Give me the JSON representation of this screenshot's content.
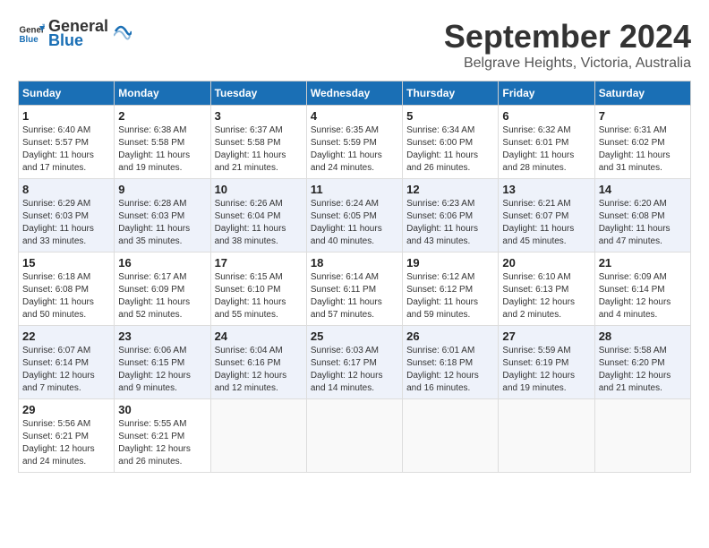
{
  "header": {
    "logo_general": "General",
    "logo_blue": "Blue",
    "month_year": "September 2024",
    "location": "Belgrave Heights, Victoria, Australia"
  },
  "weekdays": [
    "Sunday",
    "Monday",
    "Tuesday",
    "Wednesday",
    "Thursday",
    "Friday",
    "Saturday"
  ],
  "weeks": [
    [
      {
        "day": "1",
        "info": "Sunrise: 6:40 AM\nSunset: 5:57 PM\nDaylight: 11 hours\nand 17 minutes."
      },
      {
        "day": "2",
        "info": "Sunrise: 6:38 AM\nSunset: 5:58 PM\nDaylight: 11 hours\nand 19 minutes."
      },
      {
        "day": "3",
        "info": "Sunrise: 6:37 AM\nSunset: 5:58 PM\nDaylight: 11 hours\nand 21 minutes."
      },
      {
        "day": "4",
        "info": "Sunrise: 6:35 AM\nSunset: 5:59 PM\nDaylight: 11 hours\nand 24 minutes."
      },
      {
        "day": "5",
        "info": "Sunrise: 6:34 AM\nSunset: 6:00 PM\nDaylight: 11 hours\nand 26 minutes."
      },
      {
        "day": "6",
        "info": "Sunrise: 6:32 AM\nSunset: 6:01 PM\nDaylight: 11 hours\nand 28 minutes."
      },
      {
        "day": "7",
        "info": "Sunrise: 6:31 AM\nSunset: 6:02 PM\nDaylight: 11 hours\nand 31 minutes."
      }
    ],
    [
      {
        "day": "8",
        "info": "Sunrise: 6:29 AM\nSunset: 6:03 PM\nDaylight: 11 hours\nand 33 minutes."
      },
      {
        "day": "9",
        "info": "Sunrise: 6:28 AM\nSunset: 6:03 PM\nDaylight: 11 hours\nand 35 minutes."
      },
      {
        "day": "10",
        "info": "Sunrise: 6:26 AM\nSunset: 6:04 PM\nDaylight: 11 hours\nand 38 minutes."
      },
      {
        "day": "11",
        "info": "Sunrise: 6:24 AM\nSunset: 6:05 PM\nDaylight: 11 hours\nand 40 minutes."
      },
      {
        "day": "12",
        "info": "Sunrise: 6:23 AM\nSunset: 6:06 PM\nDaylight: 11 hours\nand 43 minutes."
      },
      {
        "day": "13",
        "info": "Sunrise: 6:21 AM\nSunset: 6:07 PM\nDaylight: 11 hours\nand 45 minutes."
      },
      {
        "day": "14",
        "info": "Sunrise: 6:20 AM\nSunset: 6:08 PM\nDaylight: 11 hours\nand 47 minutes."
      }
    ],
    [
      {
        "day": "15",
        "info": "Sunrise: 6:18 AM\nSunset: 6:08 PM\nDaylight: 11 hours\nand 50 minutes."
      },
      {
        "day": "16",
        "info": "Sunrise: 6:17 AM\nSunset: 6:09 PM\nDaylight: 11 hours\nand 52 minutes."
      },
      {
        "day": "17",
        "info": "Sunrise: 6:15 AM\nSunset: 6:10 PM\nDaylight: 11 hours\nand 55 minutes."
      },
      {
        "day": "18",
        "info": "Sunrise: 6:14 AM\nSunset: 6:11 PM\nDaylight: 11 hours\nand 57 minutes."
      },
      {
        "day": "19",
        "info": "Sunrise: 6:12 AM\nSunset: 6:12 PM\nDaylight: 11 hours\nand 59 minutes."
      },
      {
        "day": "20",
        "info": "Sunrise: 6:10 AM\nSunset: 6:13 PM\nDaylight: 12 hours\nand 2 minutes."
      },
      {
        "day": "21",
        "info": "Sunrise: 6:09 AM\nSunset: 6:14 PM\nDaylight: 12 hours\nand 4 minutes."
      }
    ],
    [
      {
        "day": "22",
        "info": "Sunrise: 6:07 AM\nSunset: 6:14 PM\nDaylight: 12 hours\nand 7 minutes."
      },
      {
        "day": "23",
        "info": "Sunrise: 6:06 AM\nSunset: 6:15 PM\nDaylight: 12 hours\nand 9 minutes."
      },
      {
        "day": "24",
        "info": "Sunrise: 6:04 AM\nSunset: 6:16 PM\nDaylight: 12 hours\nand 12 minutes."
      },
      {
        "day": "25",
        "info": "Sunrise: 6:03 AM\nSunset: 6:17 PM\nDaylight: 12 hours\nand 14 minutes."
      },
      {
        "day": "26",
        "info": "Sunrise: 6:01 AM\nSunset: 6:18 PM\nDaylight: 12 hours\nand 16 minutes."
      },
      {
        "day": "27",
        "info": "Sunrise: 5:59 AM\nSunset: 6:19 PM\nDaylight: 12 hours\nand 19 minutes."
      },
      {
        "day": "28",
        "info": "Sunrise: 5:58 AM\nSunset: 6:20 PM\nDaylight: 12 hours\nand 21 minutes."
      }
    ],
    [
      {
        "day": "29",
        "info": "Sunrise: 5:56 AM\nSunset: 6:21 PM\nDaylight: 12 hours\nand 24 minutes."
      },
      {
        "day": "30",
        "info": "Sunrise: 5:55 AM\nSunset: 6:21 PM\nDaylight: 12 hours\nand 26 minutes."
      },
      {
        "day": "",
        "info": ""
      },
      {
        "day": "",
        "info": ""
      },
      {
        "day": "",
        "info": ""
      },
      {
        "day": "",
        "info": ""
      },
      {
        "day": "",
        "info": ""
      }
    ]
  ]
}
